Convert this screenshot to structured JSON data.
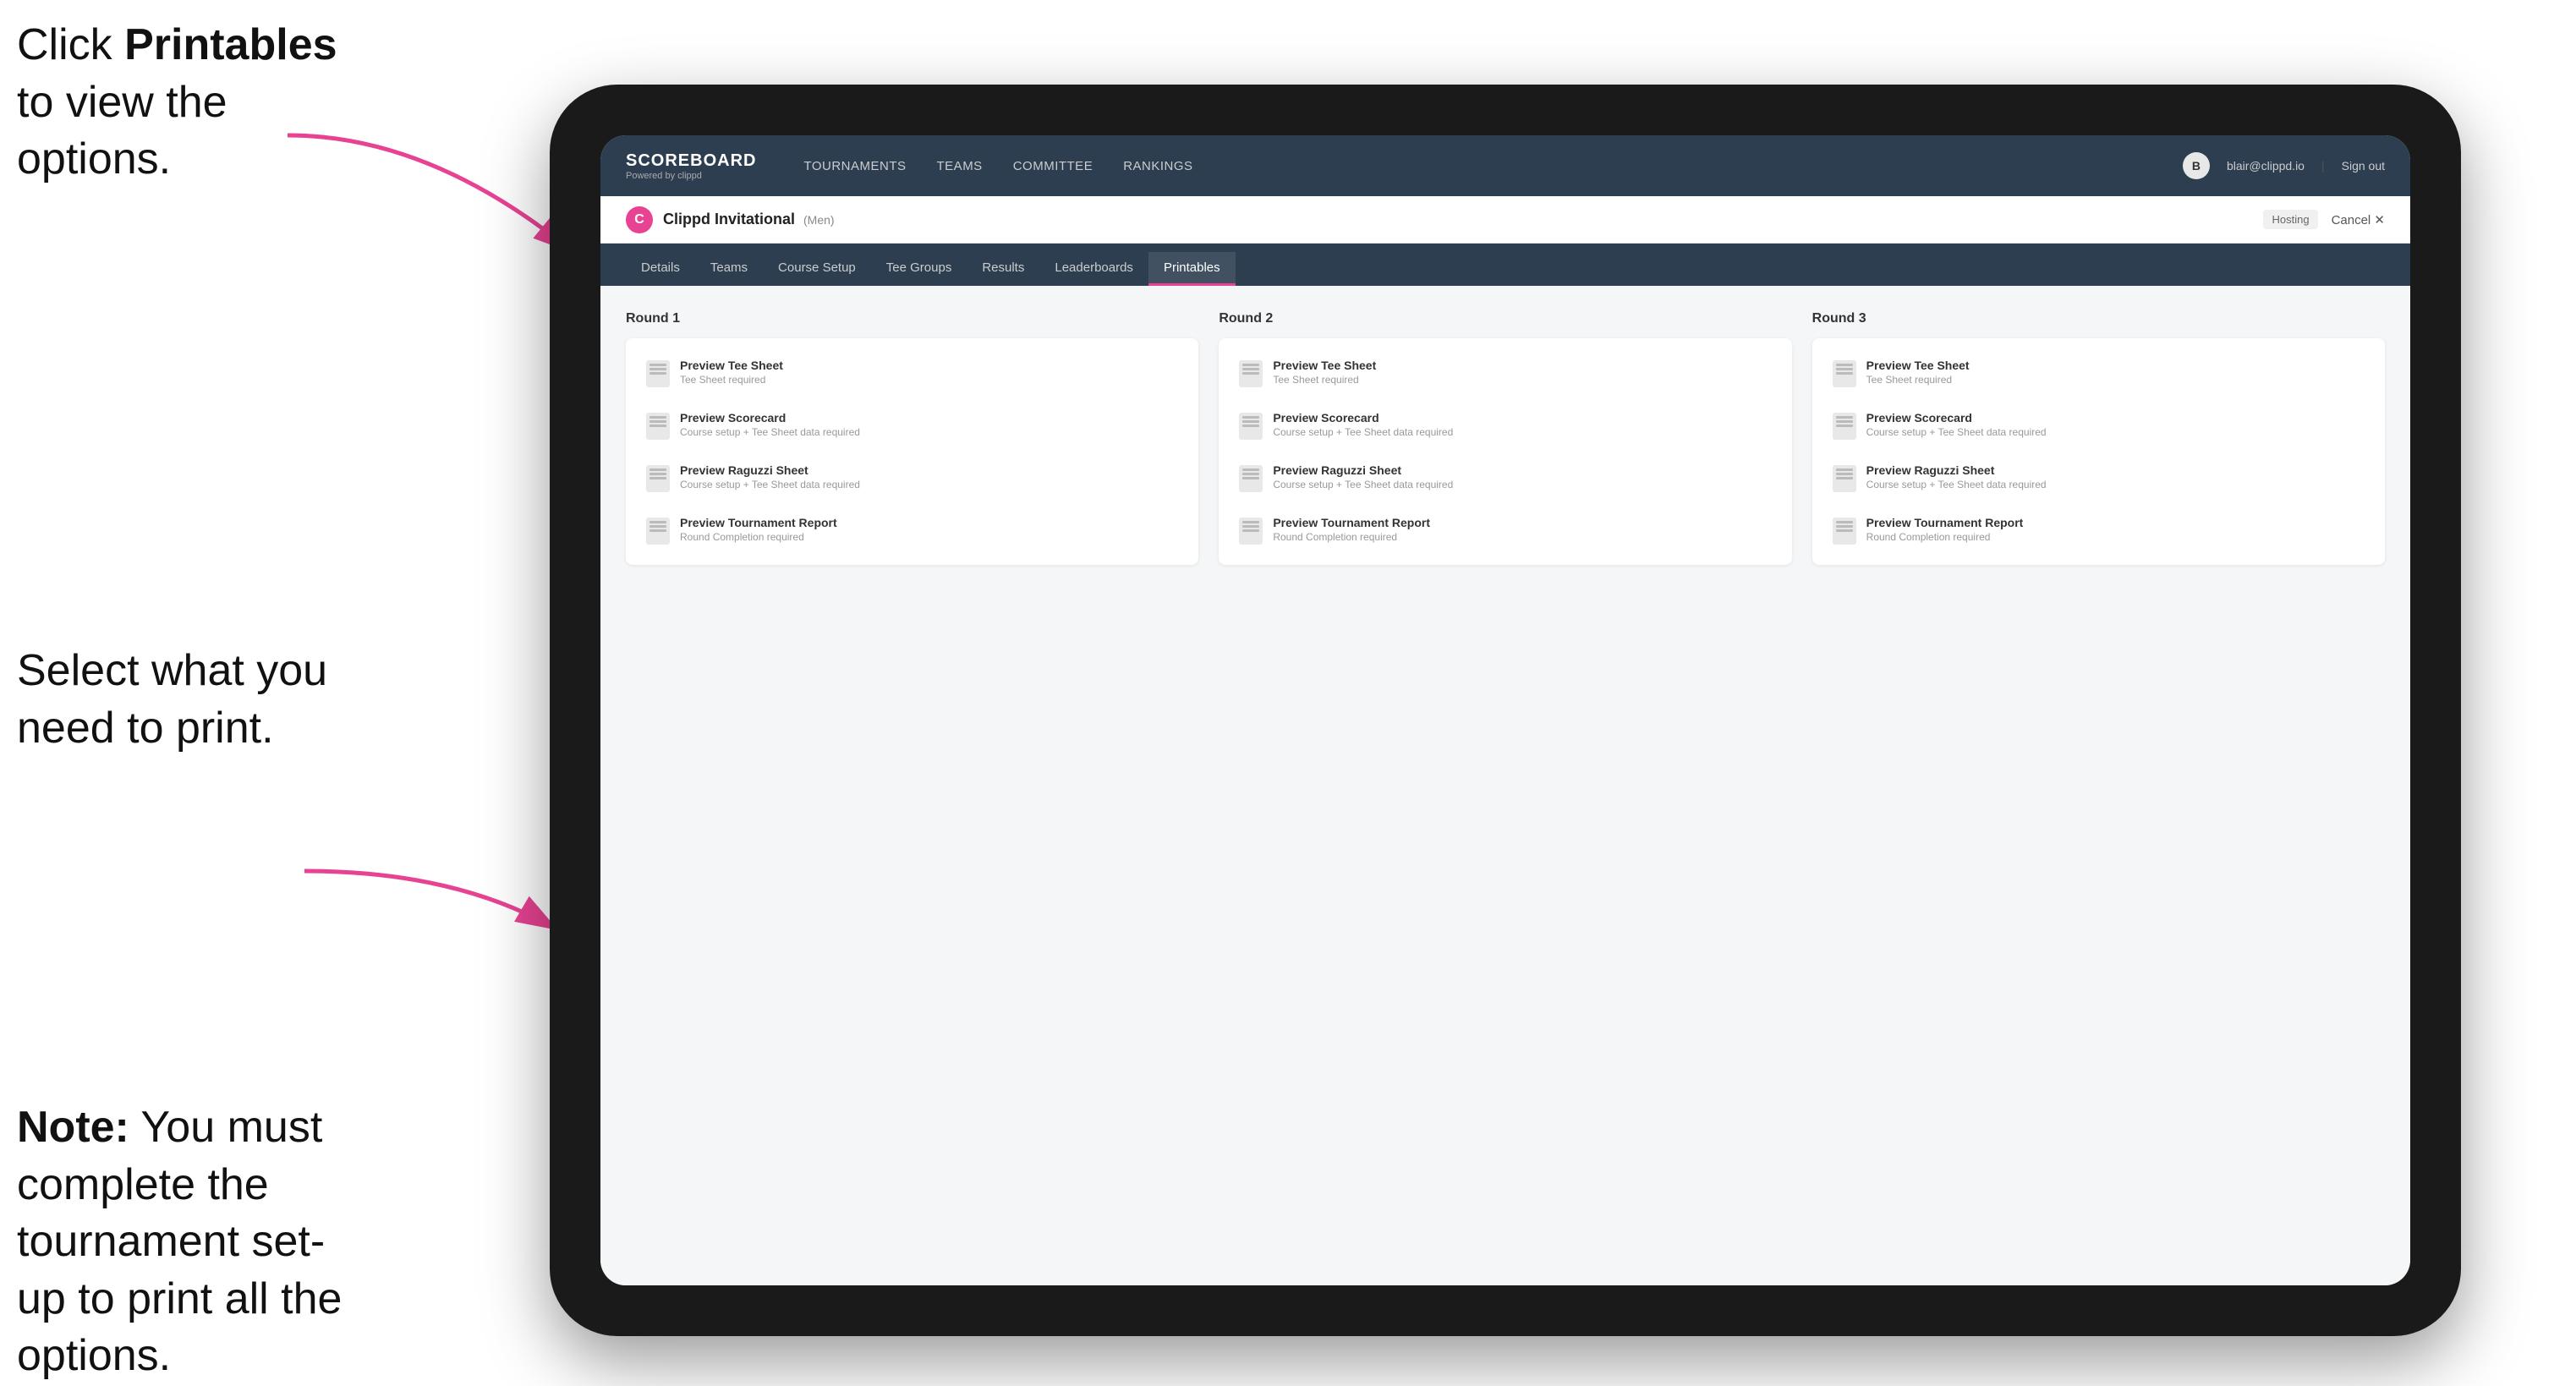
{
  "annotations": {
    "top": {
      "prefix": "Click ",
      "bold": "Printables",
      "suffix": " to view the options."
    },
    "mid": "Select what you need to print.",
    "bottom_bold": "Note:",
    "bottom_text": " You must complete the tournament set-up to print all the options."
  },
  "topNav": {
    "logo_title": "SCOREBOARD",
    "logo_sub": "Powered by clippd",
    "links": [
      "TOURNAMENTS",
      "TEAMS",
      "COMMITTEE",
      "RANKINGS"
    ],
    "user_email": "blair@clippd.io",
    "sign_out": "Sign out"
  },
  "tournamentBar": {
    "logo_letter": "C",
    "name": "Clippd Invitational",
    "sub": "(Men)",
    "hosting": "Hosting",
    "cancel": "Cancel ✕"
  },
  "subNav": {
    "tabs": [
      "Details",
      "Teams",
      "Course Setup",
      "Tee Groups",
      "Results",
      "Leaderboards",
      "Printables"
    ],
    "active": "Printables"
  },
  "rounds": [
    {
      "title": "Round 1",
      "items": [
        {
          "label": "Preview Tee Sheet",
          "sublabel": "Tee Sheet required"
        },
        {
          "label": "Preview Scorecard",
          "sublabel": "Course setup + Tee Sheet data required"
        },
        {
          "label": "Preview Raguzzi Sheet",
          "sublabel": "Course setup + Tee Sheet data required"
        },
        {
          "label": "Preview Tournament Report",
          "sublabel": "Round Completion required"
        }
      ]
    },
    {
      "title": "Round 2",
      "items": [
        {
          "label": "Preview Tee Sheet",
          "sublabel": "Tee Sheet required"
        },
        {
          "label": "Preview Scorecard",
          "sublabel": "Course setup + Tee Sheet data required"
        },
        {
          "label": "Preview Raguzzi Sheet",
          "sublabel": "Course setup + Tee Sheet data required"
        },
        {
          "label": "Preview Tournament Report",
          "sublabel": "Round Completion required"
        }
      ]
    },
    {
      "title": "Round 3",
      "items": [
        {
          "label": "Preview Tee Sheet",
          "sublabel": "Tee Sheet required"
        },
        {
          "label": "Preview Scorecard",
          "sublabel": "Course setup + Tee Sheet data required"
        },
        {
          "label": "Preview Raguzzi Sheet",
          "sublabel": "Course setup + Tee Sheet data required"
        },
        {
          "label": "Preview Tournament Report",
          "sublabel": "Round Completion required"
        }
      ]
    }
  ]
}
